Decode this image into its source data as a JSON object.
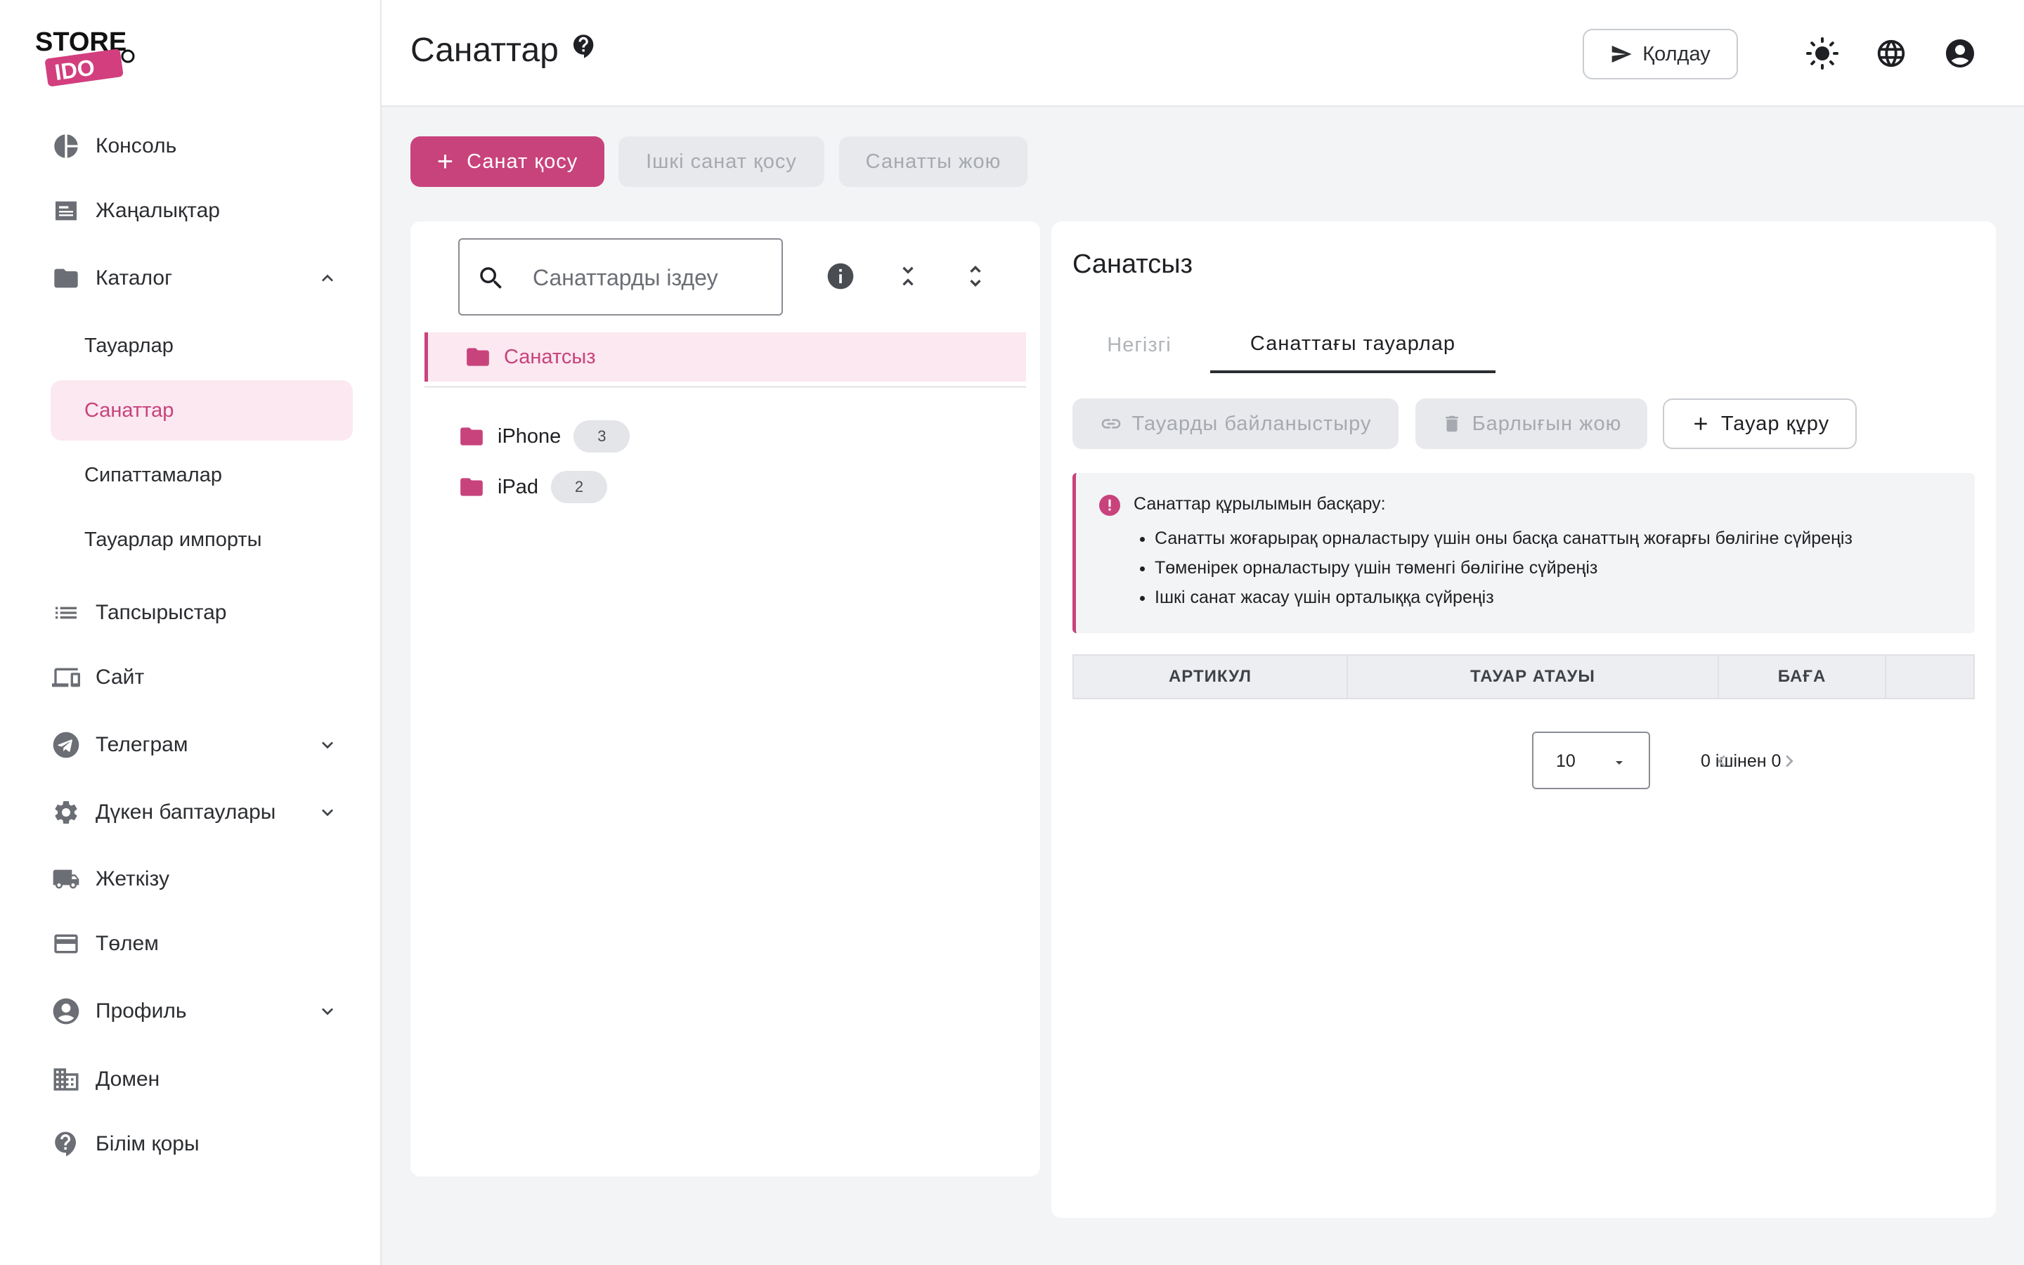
{
  "brand": {
    "logo_top": "STORE",
    "logo_bottom": "IDO"
  },
  "sidebar": {
    "items": [
      {
        "label": "Консоль",
        "icon": "pie-chart-icon"
      },
      {
        "label": "Жаңалықтар",
        "icon": "news-icon"
      },
      {
        "label": "Каталог",
        "icon": "folder-icon",
        "expanded": true
      },
      {
        "label": "Тапсырыстар",
        "icon": "list-icon"
      },
      {
        "label": "Сайт",
        "icon": "devices-icon"
      },
      {
        "label": "Телеграм",
        "icon": "telegram-icon"
      },
      {
        "label": "Дүкен баптаулары",
        "icon": "gear-icon"
      },
      {
        "label": "Жеткізу",
        "icon": "truck-icon"
      },
      {
        "label": "Төлем",
        "icon": "credit-card-icon"
      },
      {
        "label": "Профиль",
        "icon": "account-icon"
      },
      {
        "label": "Домен",
        "icon": "building-icon"
      },
      {
        "label": "Білім қоры",
        "icon": "help-icon"
      }
    ],
    "catalog_sub": [
      "Тауарлар",
      "Санаттар",
      "Сипаттамалар",
      "Тауарлар импорты"
    ],
    "active_sub": "Санаттар"
  },
  "header": {
    "title": "Санаттар",
    "support_label": "Қолдау"
  },
  "toolbar": {
    "add_category": "Санат қосу",
    "add_subcategory": "Ішкі санат қосу",
    "delete_category": "Санатты жою"
  },
  "tree": {
    "search_placeholder": "Санаттарды іздеу",
    "selected": "Санатсыз",
    "items": [
      {
        "label": "iPhone",
        "count": "3"
      },
      {
        "label": "iPad",
        "count": "2"
      }
    ]
  },
  "detail": {
    "title": "Санатсыз",
    "tabs": [
      "Негізгі",
      "Санаттағы тауарлар"
    ],
    "active_tab": "Санаттағы тауарлар",
    "actions": {
      "link_product": "Тауарды байланыстыру",
      "delete_all": "Барлығын жою",
      "create_product": "Тауар құру"
    },
    "info": {
      "title": "Санаттар құрылымын басқару:",
      "items": [
        "Санатты жоғарырақ орналастыру үшін оны басқа санаттың жоғарғы бөлігіне сүйреңіз",
        "Төменірек орналастыру үшін төменгі бөлігіне сүйреңіз",
        "Ішкі санат жасау үшін орталыққа сүйреңіз"
      ]
    },
    "table": {
      "columns": [
        "АРТИКУЛ",
        "ТАУАР АТАУЫ",
        "БАҒА",
        ""
      ]
    },
    "pager": {
      "page_size": "10",
      "range_text": "0 ішінен 0"
    }
  },
  "colors": {
    "accent": "#c8437c",
    "accent_light": "#fbe8f0",
    "icon_gray": "#6b6e74"
  }
}
